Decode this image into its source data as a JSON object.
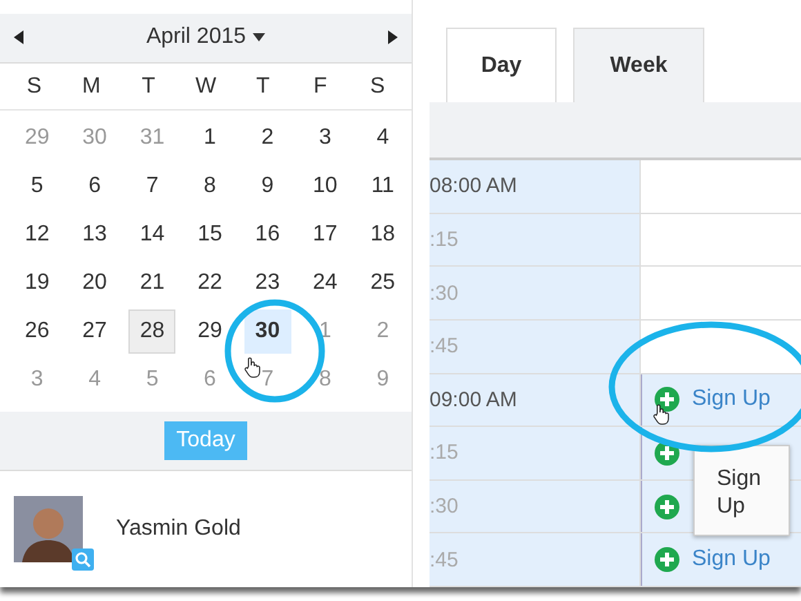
{
  "calendar": {
    "month": "April 2015",
    "weekdays": [
      "S",
      "M",
      "T",
      "W",
      "T",
      "F",
      "S"
    ],
    "weeks": [
      [
        {
          "day": "29",
          "muted": true,
          "today": false,
          "selected": false
        },
        {
          "day": "30",
          "muted": true,
          "today": false,
          "selected": false
        },
        {
          "day": "31",
          "muted": true,
          "today": false,
          "selected": false
        },
        {
          "day": "1",
          "muted": false,
          "today": false,
          "selected": false
        },
        {
          "day": "2",
          "muted": false,
          "today": false,
          "selected": false
        },
        {
          "day": "3",
          "muted": false,
          "today": false,
          "selected": false
        },
        {
          "day": "4",
          "muted": false,
          "today": false,
          "selected": false
        }
      ],
      [
        {
          "day": "5",
          "muted": false,
          "today": false,
          "selected": false
        },
        {
          "day": "6",
          "muted": false,
          "today": false,
          "selected": false
        },
        {
          "day": "7",
          "muted": false,
          "today": false,
          "selected": false
        },
        {
          "day": "8",
          "muted": false,
          "today": false,
          "selected": false
        },
        {
          "day": "9",
          "muted": false,
          "today": false,
          "selected": false
        },
        {
          "day": "10",
          "muted": false,
          "today": false,
          "selected": false
        },
        {
          "day": "11",
          "muted": false,
          "today": false,
          "selected": false
        }
      ],
      [
        {
          "day": "12",
          "muted": false,
          "today": false,
          "selected": false
        },
        {
          "day": "13",
          "muted": false,
          "today": false,
          "selected": false
        },
        {
          "day": "14",
          "muted": false,
          "today": false,
          "selected": false
        },
        {
          "day": "15",
          "muted": false,
          "today": false,
          "selected": false
        },
        {
          "day": "16",
          "muted": false,
          "today": false,
          "selected": false
        },
        {
          "day": "17",
          "muted": false,
          "today": false,
          "selected": false
        },
        {
          "day": "18",
          "muted": false,
          "today": false,
          "selected": false
        }
      ],
      [
        {
          "day": "19",
          "muted": false,
          "today": false,
          "selected": false
        },
        {
          "day": "20",
          "muted": false,
          "today": false,
          "selected": false
        },
        {
          "day": "21",
          "muted": false,
          "today": false,
          "selected": false
        },
        {
          "day": "22",
          "muted": false,
          "today": false,
          "selected": false
        },
        {
          "day": "23",
          "muted": false,
          "today": false,
          "selected": false
        },
        {
          "day": "24",
          "muted": false,
          "today": false,
          "selected": false
        },
        {
          "day": "25",
          "muted": false,
          "today": false,
          "selected": false
        }
      ],
      [
        {
          "day": "26",
          "muted": false,
          "today": false,
          "selected": false
        },
        {
          "day": "27",
          "muted": false,
          "today": false,
          "selected": false
        },
        {
          "day": "28",
          "muted": false,
          "today": true,
          "selected": false
        },
        {
          "day": "29",
          "muted": false,
          "today": false,
          "selected": false
        },
        {
          "day": "30",
          "muted": false,
          "today": false,
          "selected": true
        },
        {
          "day": "1",
          "muted": true,
          "today": false,
          "selected": false
        },
        {
          "day": "2",
          "muted": true,
          "today": false,
          "selected": false
        }
      ],
      [
        {
          "day": "3",
          "muted": true,
          "today": false,
          "selected": false
        },
        {
          "day": "4",
          "muted": true,
          "today": false,
          "selected": false
        },
        {
          "day": "5",
          "muted": true,
          "today": false,
          "selected": false
        },
        {
          "day": "6",
          "muted": true,
          "today": false,
          "selected": false
        },
        {
          "day": "7",
          "muted": true,
          "today": false,
          "selected": false
        },
        {
          "day": "8",
          "muted": true,
          "today": false,
          "selected": false
        },
        {
          "day": "9",
          "muted": true,
          "today": false,
          "selected": false
        }
      ]
    ],
    "today_button": "Today"
  },
  "user": {
    "name": "Yasmin Gold"
  },
  "tabs": [
    {
      "label": "Day",
      "selected": true
    },
    {
      "label": "Week",
      "selected": false
    }
  ],
  "slots": [
    {
      "time": "08:00 AM",
      "kind": "empty"
    },
    {
      "time": ":15",
      "kind": "empty"
    },
    {
      "time": ":30",
      "kind": "empty"
    },
    {
      "time": ":45",
      "kind": "empty"
    },
    {
      "time": "09:00 AM",
      "kind": "signup",
      "label": "Sign Up"
    },
    {
      "time": ":15",
      "kind": "signup"
    },
    {
      "time": ":30",
      "kind": "signup"
    },
    {
      "time": ":45",
      "kind": "signup",
      "label": "Sign Up"
    }
  ],
  "tooltip": "Sign Up"
}
